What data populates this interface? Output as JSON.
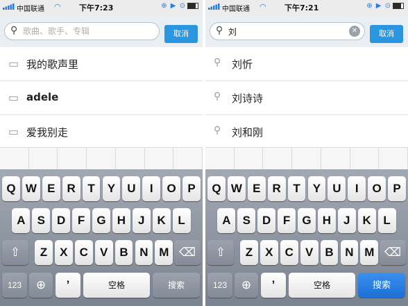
{
  "screens": [
    {
      "status": {
        "carrier": "中国联通",
        "time": "下午7:23",
        "icons": "⊕ ▶ ⊙"
      },
      "search": {
        "value": "",
        "placeholder": "歌曲、歌手、专辑",
        "cancel": "取消"
      },
      "list": [
        {
          "label": "我的歌声里",
          "icon": "book-icon"
        },
        {
          "label": "adele",
          "icon": "book-icon"
        },
        {
          "label": "爱我别走",
          "icon": "book-icon"
        }
      ],
      "keyboard": {
        "row1": [
          "Q",
          "W",
          "E",
          "R",
          "T",
          "Y",
          "U",
          "I",
          "O",
          "P"
        ],
        "row2": [
          "A",
          "S",
          "D",
          "F",
          "G",
          "H",
          "J",
          "K",
          "L"
        ],
        "row3": [
          "Z",
          "X",
          "C",
          "V",
          "B",
          "N",
          "M"
        ],
        "shift": "⇧",
        "delete": "⌫",
        "num": "123",
        "globe": "⊕",
        "comma": "’",
        "space": "空格",
        "search": "搜索",
        "search_active": false
      }
    },
    {
      "status": {
        "carrier": "中国联通",
        "time": "下午7:21",
        "icons": "⊕ ▶ ⊙"
      },
      "search": {
        "value": "刘",
        "placeholder": "",
        "cancel": "取消"
      },
      "list": [
        {
          "label": "刘忻",
          "icon": "magnifier-icon"
        },
        {
          "label": "刘诗诗",
          "icon": "magnifier-icon"
        },
        {
          "label": "刘和刚",
          "icon": "magnifier-icon"
        }
      ],
      "keyboard": {
        "row1": [
          "Q",
          "W",
          "E",
          "R",
          "T",
          "Y",
          "U",
          "I",
          "O",
          "P"
        ],
        "row2": [
          "A",
          "S",
          "D",
          "F",
          "G",
          "H",
          "J",
          "K",
          "L"
        ],
        "row3": [
          "Z",
          "X",
          "C",
          "V",
          "B",
          "N",
          "M"
        ],
        "shift": "⇧",
        "delete": "⌫",
        "num": "123",
        "globe": "⊕",
        "comma": "’",
        "space": "空格",
        "search": "搜索",
        "search_active": true
      }
    }
  ],
  "colors": {
    "accent": "#2c95e0",
    "search_active": "#1f6fd6",
    "keyboard_bg": "#8d95a1"
  }
}
